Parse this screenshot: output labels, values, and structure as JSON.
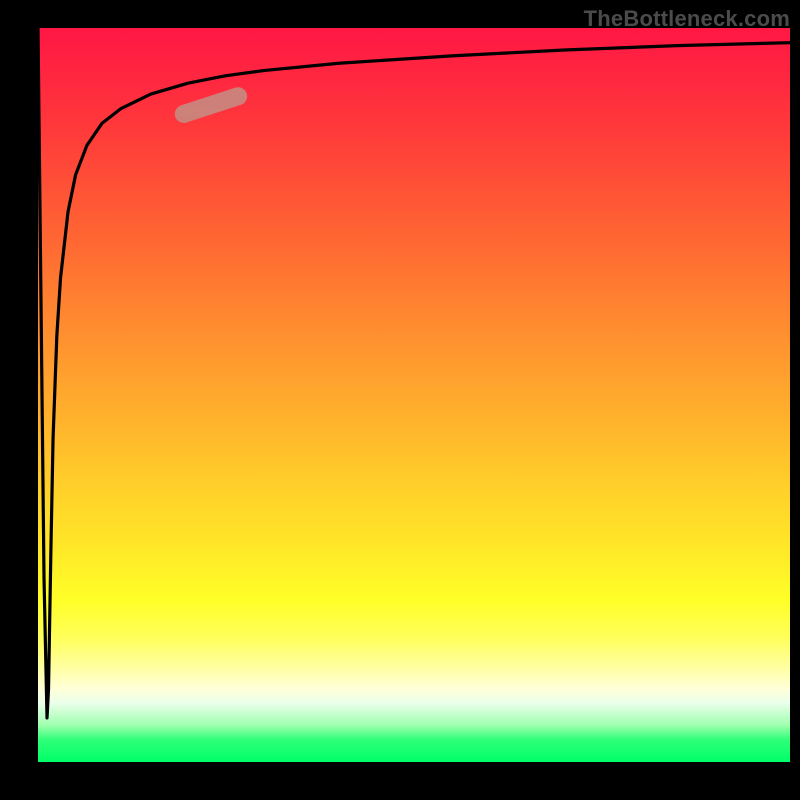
{
  "watermark": "TheBottleneck.com",
  "colors": {
    "gradient_top": "#ff1744",
    "gradient_mid1": "#ff8430",
    "gradient_mid2": "#ffff28",
    "gradient_bottom": "#00ff68",
    "curve": "#000000",
    "marker": "#c68a80",
    "axis": "#000000"
  },
  "chart_data": {
    "type": "line",
    "title": "",
    "xlabel": "",
    "ylabel": "",
    "xlim": [
      0,
      100
    ],
    "ylim": [
      0,
      100
    ],
    "series": [
      {
        "name": "bottleneck-curve",
        "x": [
          0,
          0.8,
          1.2,
          1.4,
          1.7,
          2.0,
          2.5,
          3.0,
          4.0,
          5.0,
          6.5,
          8.5,
          11,
          15,
          20,
          25,
          30,
          40,
          55,
          70,
          85,
          100
        ],
        "y": [
          100,
          25,
          6,
          10,
          28,
          44,
          58,
          66,
          75,
          80,
          84,
          87,
          89,
          91,
          92.5,
          93.5,
          94.2,
          95.2,
          96.2,
          97,
          97.6,
          98
        ]
      }
    ],
    "annotations": [
      {
        "name": "highlight-marker",
        "x_range": [
          18,
          28
        ],
        "y_range": [
          88,
          91
        ],
        "color": "#c68a80"
      }
    ]
  }
}
